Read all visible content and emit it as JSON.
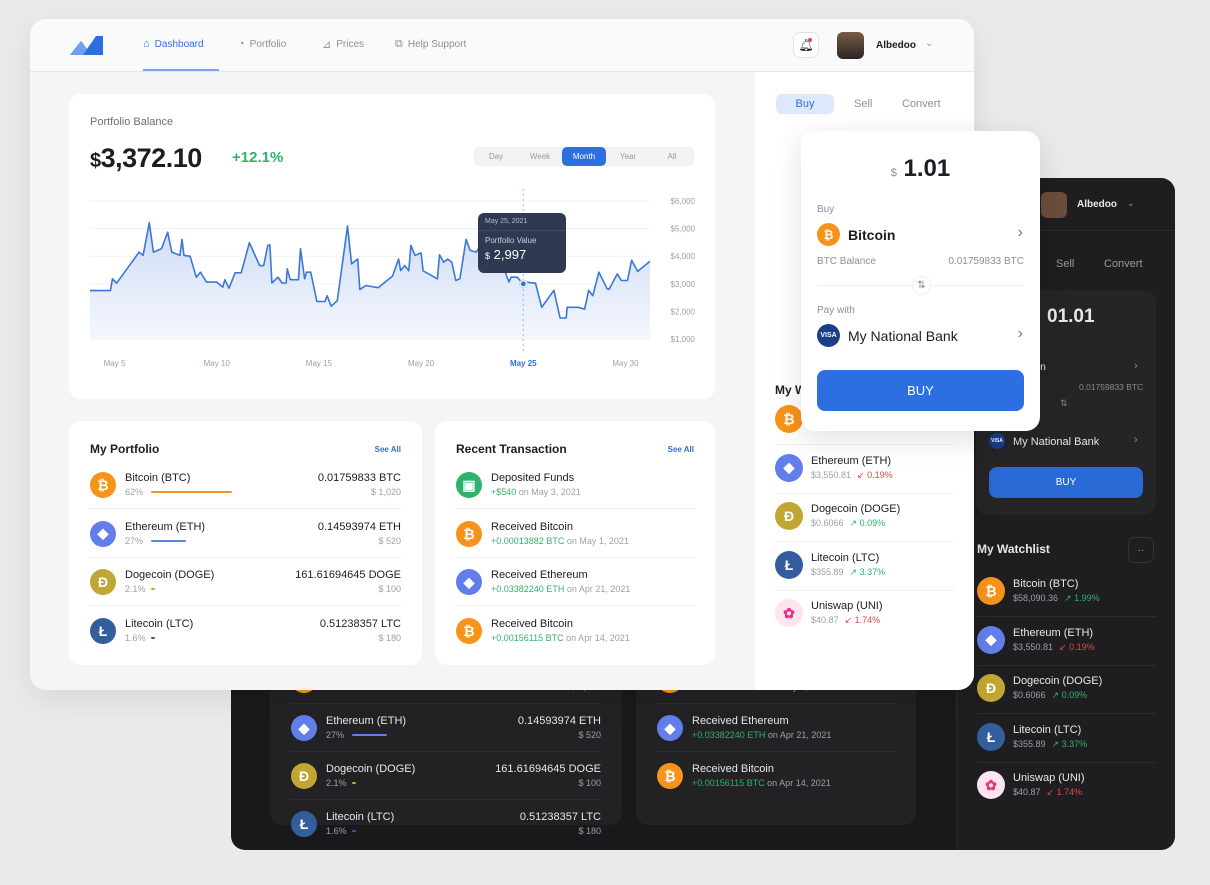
{
  "colors": {
    "accent": "#2d6fe0",
    "positive": "#2fb36b",
    "negative": "#e0474c",
    "btc": "#f7931a",
    "eth": "#627eea",
    "doge": "#c2a633",
    "ltc": "#345d9d",
    "uni": "#e8327f"
  },
  "header": {
    "nav": [
      {
        "label": "Dashboard",
        "icon": "home-icon",
        "active": true
      },
      {
        "label": "Portfolio",
        "icon": "pie-chart-icon"
      },
      {
        "label": "Prices",
        "icon": "trend-icon"
      },
      {
        "label": "Help Support",
        "icon": "chat-icon"
      }
    ],
    "user": "Albedoo"
  },
  "balance": {
    "title": "Portfolio Balance",
    "currency": "$",
    "amount": "3,372.10",
    "change": "+12.1%",
    "ranges": [
      "Day",
      "Week",
      "Month",
      "Year",
      "All"
    ],
    "active_range": "Month"
  },
  "tooltip": {
    "date": "May 25, 2021",
    "label": "Portfolio Value",
    "currency": "$",
    "value": "2,997"
  },
  "chart_data": {
    "type": "area",
    "xlabel": "",
    "ylabel": "",
    "x_unit": "day of May 2021",
    "x_ticks": [
      "May 5",
      "May 10",
      "May 15",
      "May 20",
      "May 25",
      "May 30"
    ],
    "x_tick_values": [
      5,
      10,
      15,
      20,
      25,
      30
    ],
    "highlight_tick": "May 25",
    "y_ticks": [
      "$6,000",
      "$5,000",
      "$4,000",
      "$3,000",
      "$2,000",
      "$1,000"
    ],
    "y_tick_values": [
      6000,
      5000,
      4000,
      3000,
      2000,
      1000
    ],
    "ylim": [
      1000,
      6000
    ],
    "xlim": [
      3.8,
      31.2
    ],
    "grid": true,
    "x": [
      3.8,
      4.8,
      4.9,
      5.1,
      6.2,
      6.4,
      6.7,
      6.9,
      7.3,
      7.6,
      7.8,
      8.2,
      8.3,
      8.4,
      8.7,
      9.0,
      9.2,
      9.5,
      10.0,
      10.3,
      10.4,
      10.6,
      10.9,
      11.2,
      11.6,
      12.1,
      12.3,
      12.5,
      12.6,
      12.7,
      13.0,
      13.2,
      13.4,
      13.45,
      13.6,
      14.0,
      14.1,
      14.3,
      14.4,
      14.6,
      14.9,
      15.3,
      15.4,
      15.6,
      15.9,
      16.4,
      16.6,
      16.9,
      17.0,
      17.3,
      17.9,
      18.6,
      18.9,
      19.0,
      19.2,
      19.4,
      19.5,
      19.7,
      20.0,
      20.1,
      20.8,
      20.9,
      21.1,
      21.3,
      21.5,
      21.7,
      21.9,
      22.2,
      22.4,
      22.7,
      22.9,
      23.1,
      23.8,
      24.0,
      24.3,
      24.4,
      24.7,
      25.0,
      25.1,
      25.6,
      25.9,
      26.5,
      26.8,
      27.1,
      27.15,
      27.7,
      28.0,
      28.2,
      28.4,
      28.7,
      29.1,
      29.2,
      29.6,
      29.8,
      30.1,
      30.3,
      30.6,
      31.2
    ],
    "y": [
      2755,
      2755,
      3180,
      3020,
      4150,
      4030,
      5210,
      4150,
      4270,
      4870,
      4150,
      4030,
      4610,
      4030,
      4000,
      3240,
      3420,
      3060,
      3060,
      2880,
      3150,
      2840,
      3400,
      3400,
      4490,
      3660,
      3660,
      4390,
      4410,
      3030,
      3240,
      3030,
      3030,
      3540,
      3150,
      3150,
      4270,
      3180,
      3420,
      3420,
      2360,
      2360,
      2570,
      2190,
      2390,
      5090,
      3720,
      3900,
      2790,
      2940,
      2860,
      3280,
      3900,
      3480,
      3660,
      3470,
      4390,
      4030,
      4120,
      3470,
      3180,
      4050,
      3780,
      3900,
      3780,
      3120,
      3180,
      4610,
      4210,
      4150,
      4390,
      3420,
      3600,
      3660,
      3060,
      3240,
      3240,
      2997,
      3060,
      3020,
      2150,
      2760,
      1760,
      1760,
      2150,
      2150,
      2080,
      2760,
      2570,
      3420,
      2820,
      2800,
      3360,
      3120,
      3120,
      3850,
      3450,
      3820
    ],
    "highlight": {
      "x": 25,
      "y": 2997
    }
  },
  "portfolio": {
    "title": "My Portfolio",
    "see_all": "See All",
    "items": [
      {
        "coin": "btc",
        "name": "Bitcoin (BTC)",
        "pct": "62%",
        "share": 62,
        "amount": "0.01759833 BTC",
        "usd": "$ 1,020"
      },
      {
        "coin": "eth",
        "name": "Ethereum (ETH)",
        "pct": "27%",
        "share": 27,
        "amount": "0.14593974 ETH",
        "usd": "$ 520"
      },
      {
        "coin": "doge",
        "name": "Dogecoin (DOGE)",
        "pct": "2.1%",
        "share": 2.1,
        "amount": "161.61694645 DOGE",
        "usd": "$ 100"
      },
      {
        "coin": "ltc",
        "name": "Litecoin (LTC)",
        "pct": "1.6%",
        "share": 1.6,
        "amount": "0.51238357  LTC",
        "usd": "$ 180"
      }
    ]
  },
  "transactions": {
    "title": "Recent Transaction",
    "see_all": "See All",
    "items": [
      {
        "coin": "wallet",
        "name": "Deposited Funds",
        "amount": "+$540",
        "unit": "",
        "date": "on May 3, 2021"
      },
      {
        "coin": "btc",
        "name": "Received Bitcoin",
        "amount": "+0.00013882",
        "unit": "BTC",
        "date": "on May 1, 2021"
      },
      {
        "coin": "eth",
        "name": "Received Ethereum",
        "amount": "+0.03382240",
        "unit": "ETH",
        "date": "on Apr 21, 2021"
      },
      {
        "coin": "btc",
        "name": "Received Bitcoin",
        "amount": "+0.00156115",
        "unit": "BTC",
        "date": "on Apr 14, 2021"
      }
    ]
  },
  "trade": {
    "tabs": [
      "Buy",
      "Sell",
      "Convert"
    ],
    "active": "Buy",
    "currency": "$",
    "amount": "1.01",
    "buy_label": "Buy",
    "asset": "Bitcoin",
    "balance_label": "BTC Balance",
    "balance": "0.01759833 BTC",
    "pay_label": "Pay with",
    "pay_method": "My National Bank",
    "card_brand": "VISA",
    "button": "BUY",
    "dark_amount": "01.01",
    "dark_asset_fragment": "in"
  },
  "watchlist": {
    "title": "My Watchlist",
    "light_title_fragment": "My W",
    "items": [
      {
        "coin": "btc",
        "name": "Bitcoin (BTC)",
        "price": "$58,090.36",
        "change": "1.99%",
        "up": true
      },
      {
        "coin": "eth",
        "name": "Ethereum (ETH)",
        "price": "$3,550.81",
        "change": "0.19%",
        "up": false
      },
      {
        "coin": "doge",
        "name": "Dogecoin (DOGE)",
        "price": "$0.6066",
        "change": "0.09%",
        "up": true
      },
      {
        "coin": "ltc",
        "name": "Litecoin (LTC)",
        "price": "$355.89",
        "change": "3.37%",
        "up": true
      },
      {
        "coin": "uni",
        "name": "Uniswap (UNI)",
        "price": "$40.87",
        "change": "1.74%",
        "up": false
      }
    ]
  }
}
